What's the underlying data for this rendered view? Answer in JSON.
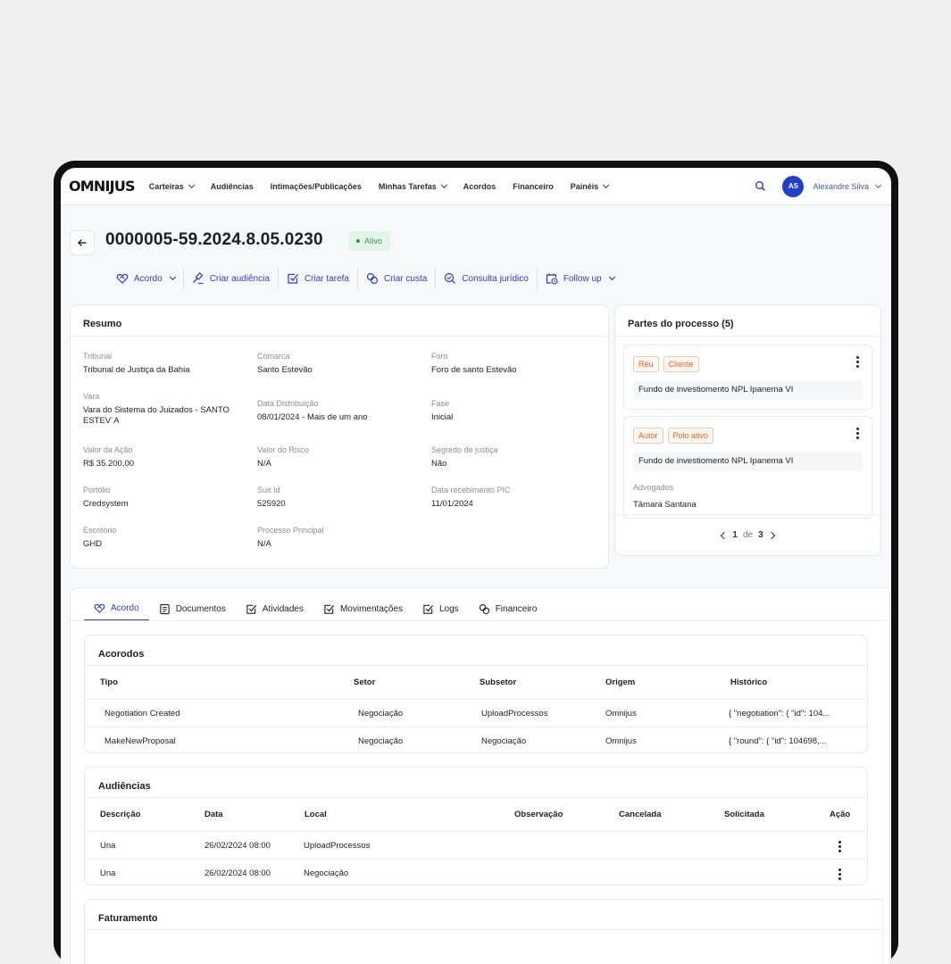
{
  "nav": {
    "logo": "OMNIJUS",
    "items": [
      "Carteiras",
      "Audiências",
      "Intimações/Publicações",
      "Minhas Tarefas",
      "Acordos",
      "Financeiro",
      "Painéis"
    ],
    "user_initials": "AS",
    "user_name": "Alexandre Silva"
  },
  "header": {
    "case_number": "0000005-59.2024.8.05.0230",
    "status": "Ativo"
  },
  "actions": [
    "Acordo",
    "Criar audiência",
    "Criar tarefa",
    "Criar custa",
    "Consulta jurídico",
    "Follow up"
  ],
  "resumo": {
    "title": "Resumo",
    "fields": [
      {
        "label": "Tribunal",
        "value": "Tribunal de Justiça da Bahia"
      },
      {
        "label": "Comarca",
        "value": "Santo Estevão"
      },
      {
        "label": "Foro",
        "value": "Foro de santo Estevão"
      },
      {
        "label": "Vara",
        "value": "Vara do Sistema do Juizados - SANTO ESTEV¨A"
      },
      {
        "label": "Data Distribuição",
        "value": "08/01/2024 - Mais de um ano"
      },
      {
        "label": "Fase",
        "value": "Inicial"
      },
      {
        "label": "Valor da Ação",
        "value": "R$ 35.200,00"
      },
      {
        "label": "Valor do Risco",
        "value": "N/A"
      },
      {
        "label": "Segredo de justiça",
        "value": "Não"
      },
      {
        "label": "Portólio",
        "value": "Credsystem"
      },
      {
        "label": "Suit Id",
        "value": "525920"
      },
      {
        "label": "Data recebimento PIC",
        "value": "11/01/2024"
      },
      {
        "label": "Escritório",
        "value": "GHD"
      },
      {
        "label": "Processo Principal",
        "value": "N/A"
      }
    ]
  },
  "partes": {
    "title": "Partes do processo (5)",
    "items": [
      {
        "chips": [
          "Réu",
          "Cliente"
        ],
        "name": "Fundo de investiomento NPL Ipanema VI"
      },
      {
        "chips": [
          "Autor",
          "Polo ativo"
        ],
        "name": "Fundo de investiomento NPL Ipanema VI",
        "advogados_label": "Advogados",
        "advogado": "Tâmara Santana"
      }
    ],
    "page_current": "1",
    "page_of": "de",
    "page_total": "3"
  },
  "tabs": [
    "Acordo",
    "Documentos",
    "Atividades",
    "Movimentações",
    "Logs",
    "Financeiro"
  ],
  "acordos": {
    "title": "Acorodos",
    "columns": [
      "Tipo",
      "Setor",
      "Subsetor",
      "Origem",
      "Histórico"
    ],
    "rows": [
      [
        "Negotiation Created",
        "Negociação",
        "UploadProcessos",
        "Omnijus",
        "{ \"negotiation\": { \"id\": 104..."
      ],
      [
        "MakeNewProposal",
        "Negociação",
        "Negociação",
        "Omnijus",
        "{ \"round\": { \"id\": 104698,..."
      ]
    ]
  },
  "audiencias": {
    "title": "Audiências",
    "columns": [
      "Descrição",
      "Data",
      "Local",
      "Observação",
      "Cancelada",
      "Solicitada",
      "Ação"
    ],
    "rows": [
      [
        "Una",
        "26/02/2024 08:00",
        "UploadProcessos"
      ],
      [
        "Una",
        "26/02/2024 08:00",
        "Negociação"
      ]
    ]
  },
  "faturamento": {
    "title": "Faturamento"
  }
}
